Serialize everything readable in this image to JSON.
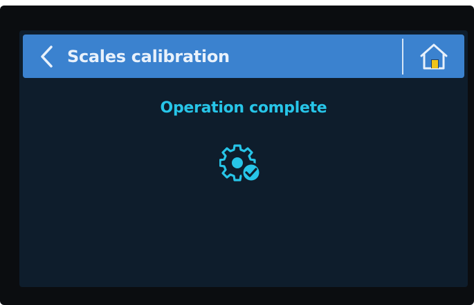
{
  "header": {
    "title": "Scales calibration",
    "back_icon": "chevron-left-icon",
    "home_icon": "home-icon"
  },
  "main": {
    "status_text": "Operation complete",
    "status_icon": "gear-check-icon"
  },
  "colors": {
    "header_bg": "#3b82cf",
    "screen_bg": "#0e1d2c",
    "accent": "#27c5e8",
    "header_text": "#e8f1fb"
  }
}
